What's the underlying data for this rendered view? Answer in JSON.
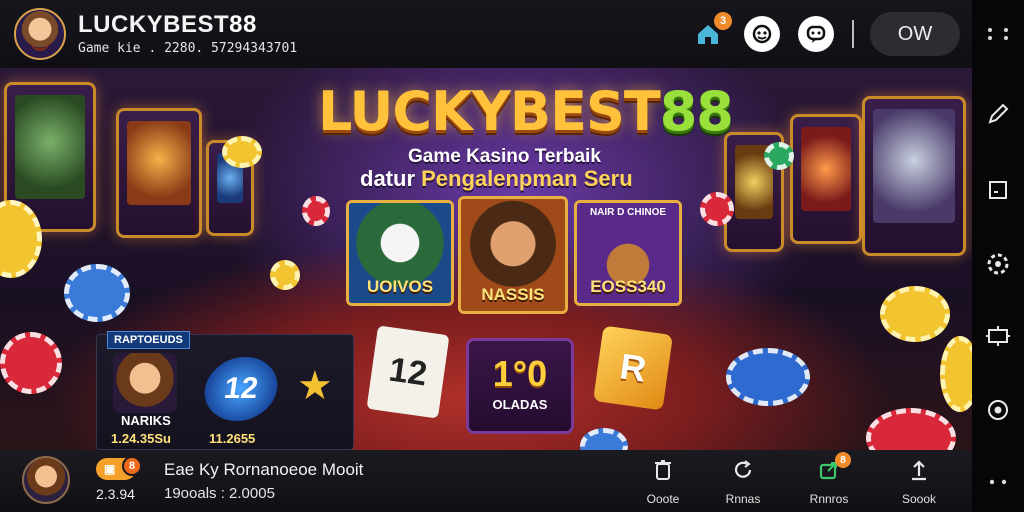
{
  "header": {
    "brand_part1": "LUCKYBEST",
    "brand_part2": "88",
    "subtitle": "Game kie . 2280. 57294343701",
    "notification_count": "3",
    "account_button": "OW"
  },
  "hero": {
    "title_part1": "LUCKYBEST",
    "title_part2": "88",
    "tagline_1": "Game Kasino Terbaik",
    "tagline_2_prefix": "datur",
    "tagline_2_highlight": "Pengalenpman Seru",
    "cards": [
      {
        "label": "UOIVOS"
      },
      {
        "label": "NASSIS"
      },
      {
        "top": "NAIR D CHINOE",
        "label": "EOSS340"
      }
    ],
    "panel": {
      "tag": "RAPTOEUDS",
      "player_name": "NARIKS",
      "player_value": "1.24.35Su",
      "logo_text": "12",
      "logo_value": "11.2655"
    },
    "playing_card": "12",
    "jackpot_tile": {
      "value": "1°0",
      "label": "OLADAS"
    },
    "bonus_card": "R"
  },
  "bottom": {
    "wallet_badge": "8",
    "balance": "2.3.94",
    "title": "Eae Ky Rornanoeoe Mooit",
    "stats": "19ooals : 2.0005",
    "nav": [
      {
        "label": "Ooote",
        "icon": "trash-icon"
      },
      {
        "label": "Rnnas",
        "icon": "refresh-icon"
      },
      {
        "label": "Rnnros",
        "icon": "share-icon",
        "badge": "8"
      },
      {
        "label": "Soook",
        "icon": "upload-icon"
      }
    ]
  },
  "colors": {
    "gold": "#ffc23a",
    "green_accent": "#9ae03a",
    "badge_orange": "#f08a2a"
  }
}
